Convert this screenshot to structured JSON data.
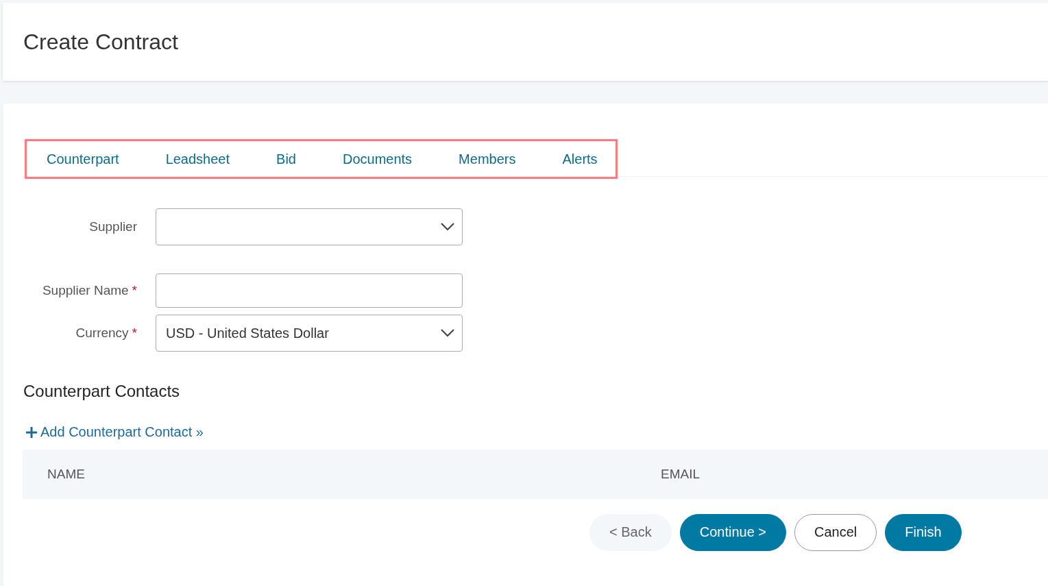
{
  "page_title": "Create Contract",
  "tabs": [
    {
      "label": "Counterpart"
    },
    {
      "label": "Leadsheet"
    },
    {
      "label": "Bid"
    },
    {
      "label": "Documents"
    },
    {
      "label": "Members"
    },
    {
      "label": "Alerts"
    }
  ],
  "form": [
    {
      "kind": "select",
      "label": "Supplier",
      "required": false
    },
    {
      "kind": "text",
      "label": "Supplier Name",
      "required": true
    },
    {
      "kind": "select",
      "label": "Currency",
      "required": true,
      "value": "USD - United States Dollar"
    }
  ],
  "required_mark": "*",
  "section_title": "Counterpart Contacts",
  "add_link": "Add Counterpart Contact »",
  "table": {
    "columns": [
      "NAME",
      "EMAIL"
    ]
  },
  "buttons": [
    {
      "kind": "light",
      "label": "< Back"
    },
    {
      "kind": "primary",
      "label": "Continue >"
    },
    {
      "kind": "outline",
      "label": "Cancel"
    },
    {
      "kind": "primary",
      "label": "Finish"
    }
  ]
}
